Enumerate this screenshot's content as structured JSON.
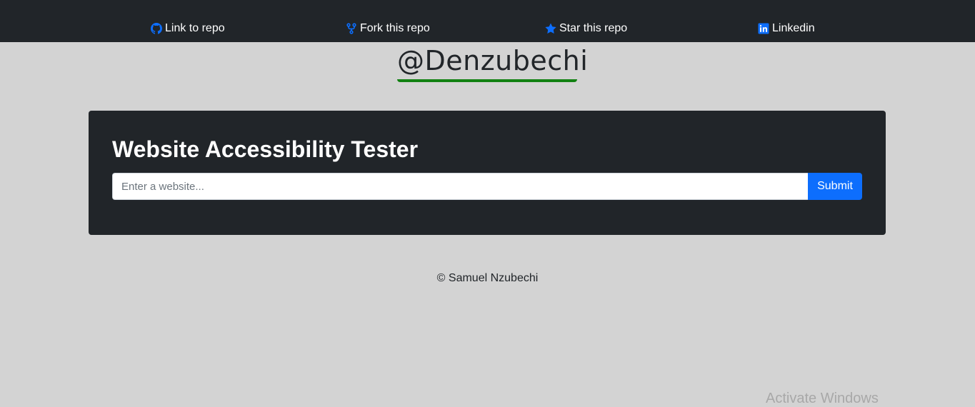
{
  "nav": {
    "items": [
      {
        "label": "Link to repo",
        "icon": "github-icon"
      },
      {
        "label": "Fork this repo",
        "icon": "fork-icon"
      },
      {
        "label": "Star this repo",
        "icon": "star-icon"
      },
      {
        "label": "Linkedin",
        "icon": "linkedin-icon"
      }
    ]
  },
  "brand": {
    "handle": "@Denzubechi"
  },
  "tester": {
    "title": "Website Accessibility Tester",
    "input_value": "",
    "input_placeholder": "Enter a website...",
    "submit_label": "Submit"
  },
  "footer": {
    "text": "© Samuel Nzubechi"
  },
  "watermark": {
    "text": "Activate Windows"
  },
  "colors": {
    "nav_bg": "#212529",
    "page_bg": "#d3d3d3",
    "card_bg": "#212529",
    "icon_accent": "#0d6efd",
    "button_bg": "#0d6efd",
    "brand_underline": "#128112"
  }
}
